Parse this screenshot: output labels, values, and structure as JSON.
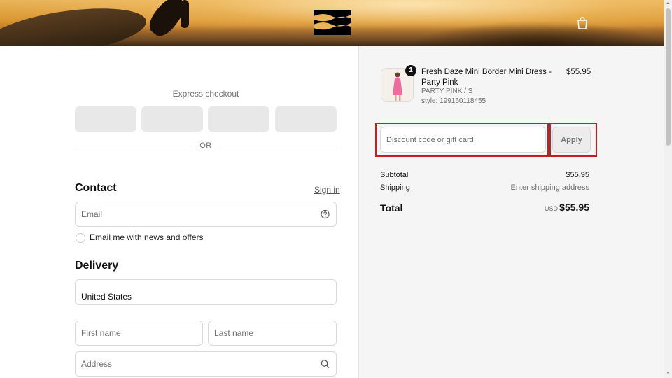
{
  "header": {
    "logo_icon": "billabong-wave-logo-icon",
    "cart_icon": "shopping-bag-icon"
  },
  "express": {
    "label": "Express checkout",
    "buttons": 4,
    "or_text": "OR"
  },
  "contact": {
    "title": "Contact",
    "signin_label": "Sign in",
    "email_placeholder": "Email",
    "newsletter_label": "Email me with news and offers"
  },
  "delivery": {
    "title": "Delivery",
    "country_value": "United States",
    "first_name_placeholder": "First name",
    "last_name_placeholder": "Last name",
    "address_placeholder": "Address"
  },
  "order": {
    "item": {
      "quantity": "1",
      "name": "Fresh Daze Mini Border Mini Dress - Party Pink",
      "variant": "PARTY PINK / S",
      "style": "style: 199160118455",
      "price": "$55.95"
    },
    "discount_placeholder": "Discount code or gift card",
    "apply_label": "Apply",
    "subtotal_label": "Subtotal",
    "subtotal_value": "$55.95",
    "shipping_label": "Shipping",
    "shipping_value": "Enter shipping address",
    "total_label": "Total",
    "currency": "USD",
    "total_value": "$55.95"
  },
  "colors": {
    "accent_outline": "#d0181f",
    "summary_bg": "#f5f5f5"
  }
}
